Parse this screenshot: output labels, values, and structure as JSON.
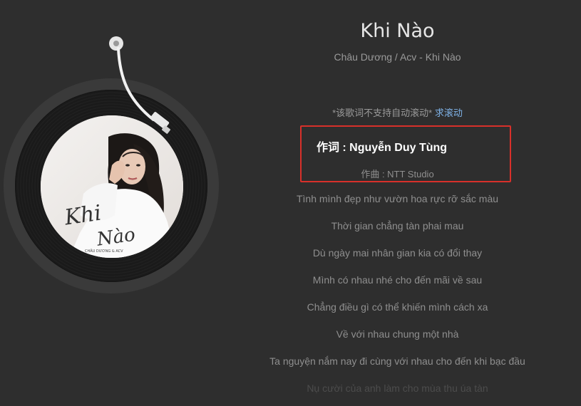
{
  "song": {
    "title": "Khi Nào",
    "subtitle": "Châu Dương / Acv - Khi Nào"
  },
  "cover": {
    "script_title": "Khi Nào",
    "caption": "CHÂU DƯƠNG & ACV"
  },
  "lyrics": {
    "notice": "*该歌词不支持自动滚动*",
    "notice_link": "求滚动",
    "lines": [
      "作词 : Nguyễn Duy Tùng",
      "作曲 : NTT Studio",
      "Tình mình đẹp như vườn hoa rực rỡ sắc màu",
      "Thời gian chẳng tàn phai mau",
      "Dù ngày mai nhân gian kia có đổi thay",
      "Mình có nhau nhé cho đến mãi về sau",
      "Chẳng điều gì có thể khiến mình cách xa",
      "Về với nhau chung một nhà",
      "Ta nguyện nắm nay đi cùng với nhau cho đến khi bạc đầu",
      "Nụ cười của anh làm cho mùa thu úa tàn"
    ]
  },
  "colors": {
    "background": "#2e2e2e",
    "highlight_border": "#d8302a",
    "link": "#7fb3e8"
  }
}
